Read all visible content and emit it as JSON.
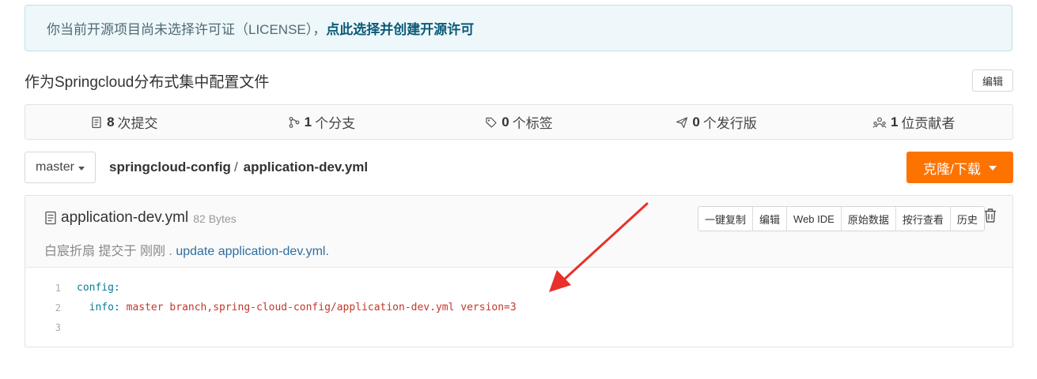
{
  "notice": {
    "text": "你当前开源项目尚未选择许可证（LICENSE），",
    "link": "点此选择并创建开源许可"
  },
  "repo": {
    "description": "作为Springcloud分布式集中配置文件",
    "edit_label": "编辑"
  },
  "stats": [
    {
      "num": "8",
      "label": "次提交",
      "icon": "commit-icon"
    },
    {
      "num": "1",
      "label": "个分支",
      "icon": "branch-icon"
    },
    {
      "num": "0",
      "label": "个标签",
      "icon": "tag-icon"
    },
    {
      "num": "0",
      "label": "个发行版",
      "icon": "release-icon"
    },
    {
      "num": "1",
      "label": "位贡献者",
      "icon": "contributors-icon"
    }
  ],
  "branch": {
    "name": "master"
  },
  "breadcrumb": {
    "repo": "springcloud-config",
    "sep": "/",
    "file": "application-dev.yml"
  },
  "clone": {
    "label": "克隆/下载"
  },
  "file": {
    "name": "application-dev.yml",
    "size": "82 Bytes",
    "author": "白宸折扇",
    "committed": "提交于",
    "time": "刚刚",
    "dot": ".",
    "message": "update application-dev.yml."
  },
  "actions": [
    "一键复制",
    "编辑",
    "Web IDE",
    "原始数据",
    "按行查看",
    "历史"
  ],
  "code": {
    "lines": [
      {
        "n": "1",
        "key": "config",
        "colon": ":",
        "value": ""
      },
      {
        "n": "2",
        "key": "info",
        "colon": ":",
        "value": " master branch,spring-cloud-config/application-dev.yml version=3"
      },
      {
        "n": "3",
        "key": "",
        "colon": "",
        "value": ""
      }
    ]
  },
  "colors": {
    "accent": "#fe7300",
    "link": "#0a5a78",
    "annotation": "#e8312a"
  }
}
